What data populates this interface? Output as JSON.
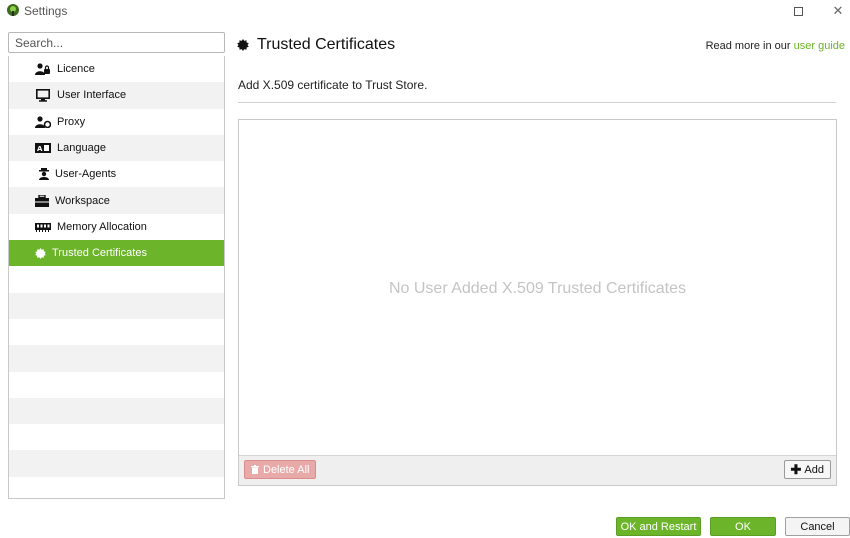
{
  "window": {
    "title": "Settings"
  },
  "sidebar": {
    "search_placeholder": "Search...",
    "items": [
      {
        "label": "Licence",
        "icon": "licence-icon"
      },
      {
        "label": "User Interface",
        "icon": "monitor-icon"
      },
      {
        "label": "Proxy",
        "icon": "proxy-icon"
      },
      {
        "label": "Language",
        "icon": "language-icon"
      },
      {
        "label": "User-Agents",
        "icon": "user-agent-icon"
      },
      {
        "label": "Workspace",
        "icon": "workspace-icon"
      },
      {
        "label": "Memory Allocation",
        "icon": "memory-icon"
      },
      {
        "label": "Trusted Certificates",
        "icon": "certificate-icon",
        "active": true
      }
    ]
  },
  "main": {
    "title": "Trusted Certificates",
    "read_more_prefix": "Read more in our ",
    "read_more_link": "user guide",
    "subtitle": "Add X.509 certificate to Trust Store.",
    "empty_message": "No User Added X.509 Trusted Certificates",
    "delete_all_label": "Delete All",
    "add_label": "Add"
  },
  "footer": {
    "ok_restart_label": "OK and Restart",
    "ok_label": "OK",
    "cancel_label": "Cancel"
  },
  "colors": {
    "accent": "#6cb42a",
    "delete": "#e8a9a9"
  }
}
